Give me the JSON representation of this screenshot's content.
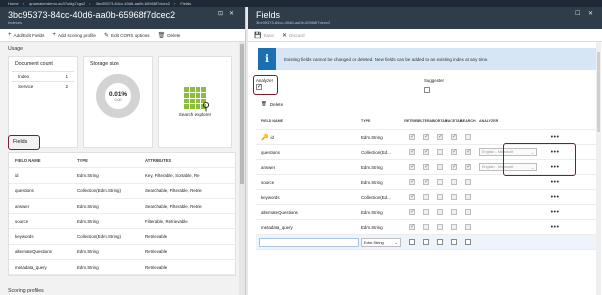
{
  "breadcrumb": [
    "Home",
    "qnamakerdemo-ac37uldg7cgs2",
    "3bc95373-84cc-40d6-aa0b-65968f7dcec2",
    "Fields"
  ],
  "left": {
    "title": "3bc95373-84cc-40d6-aa0b-65968f7dcec2",
    "subtitle": "Indexes",
    "commands": [
      {
        "icon": "plus-icon",
        "label": "Add/Edit Fields"
      },
      {
        "icon": "plus-icon",
        "label": "Add scoring profile"
      },
      {
        "icon": "pencil-icon",
        "label": "Edit CORS options"
      },
      {
        "icon": "trash-icon",
        "label": "Delete"
      }
    ],
    "usage_label": "Usage",
    "doc_count": {
      "title": "Document count",
      "rows": [
        {
          "label": "Index",
          "value": "1"
        },
        {
          "label": "Service",
          "value": "2"
        }
      ]
    },
    "storage": {
      "title": "Storage size",
      "percent": "0.01%",
      "small": "0.00"
    },
    "search_explorer": "Search explorer",
    "fields_label": "Fields",
    "fields_table": {
      "headers": [
        "FIELD NAME",
        "TYPE",
        "ATTRIBUTES"
      ],
      "rows": [
        [
          "id",
          "Edm.String",
          "Key, Filterable, Sortable, Re"
        ],
        [
          "questions",
          "Collection(Edm.String)",
          "Searchable, Filterable, Retrie"
        ],
        [
          "answer",
          "Edm.String",
          "Searchable, Filterable, Retrie"
        ],
        [
          "source",
          "Edm.String",
          "Filterable, Retrievable"
        ],
        [
          "keywords",
          "Collection(Edm.String)",
          "Retrievable"
        ],
        [
          "alternateQuestions",
          "Edm.String",
          "Retrievable"
        ],
        [
          "metadata_query",
          "Edm.String",
          "Retrievable"
        ]
      ]
    },
    "scoring_label": "Scoring profiles"
  },
  "right": {
    "title": "Fields",
    "subtitle": "3bc95373-84cc-40d6-aa0b-65968f7dcec2",
    "save": "Save",
    "discard": "Discard",
    "info_text": "Existing fields cannot be changed or deleted. New fields can be added to an existing index at any time.",
    "analyzer_label": "Analyzer",
    "suggester_label": "Suggester",
    "delete_label": "Delete",
    "headers": [
      "FIELD NAME",
      "TYPE",
      "RETRIEV",
      "FILTERAB",
      "SORTAB",
      "FACETAB",
      "SEARCH",
      "ANALYZER"
    ],
    "rows": [
      {
        "name": "id",
        "type": "Edm.String",
        "checks": [
          1,
          1,
          1,
          1,
          0
        ],
        "analyzer": ""
      },
      {
        "name": "questions",
        "type": "Collection(Ed...",
        "checks": [
          1,
          1,
          0,
          1,
          1
        ],
        "analyzer": "English - Microsoft"
      },
      {
        "name": "answer",
        "type": "Edm.String",
        "checks": [
          1,
          1,
          0,
          1,
          1
        ],
        "analyzer": "English - Microsoft"
      },
      {
        "name": "source",
        "type": "Edm.String",
        "checks": [
          1,
          1,
          0,
          0,
          0
        ],
        "analyzer": ""
      },
      {
        "name": "keywords",
        "type": "Collection(Ed...",
        "checks": [
          1,
          0,
          0,
          0,
          0
        ],
        "analyzer": ""
      },
      {
        "name": "alternateQuestions",
        "type": "Edm.String",
        "checks": [
          1,
          0,
          0,
          0,
          0
        ],
        "analyzer": ""
      },
      {
        "name": "metadata_query",
        "type": "Edm.String",
        "checks": [
          1,
          0,
          0,
          0,
          0
        ],
        "analyzer": ""
      }
    ],
    "new_row_type": "Edm.String"
  }
}
